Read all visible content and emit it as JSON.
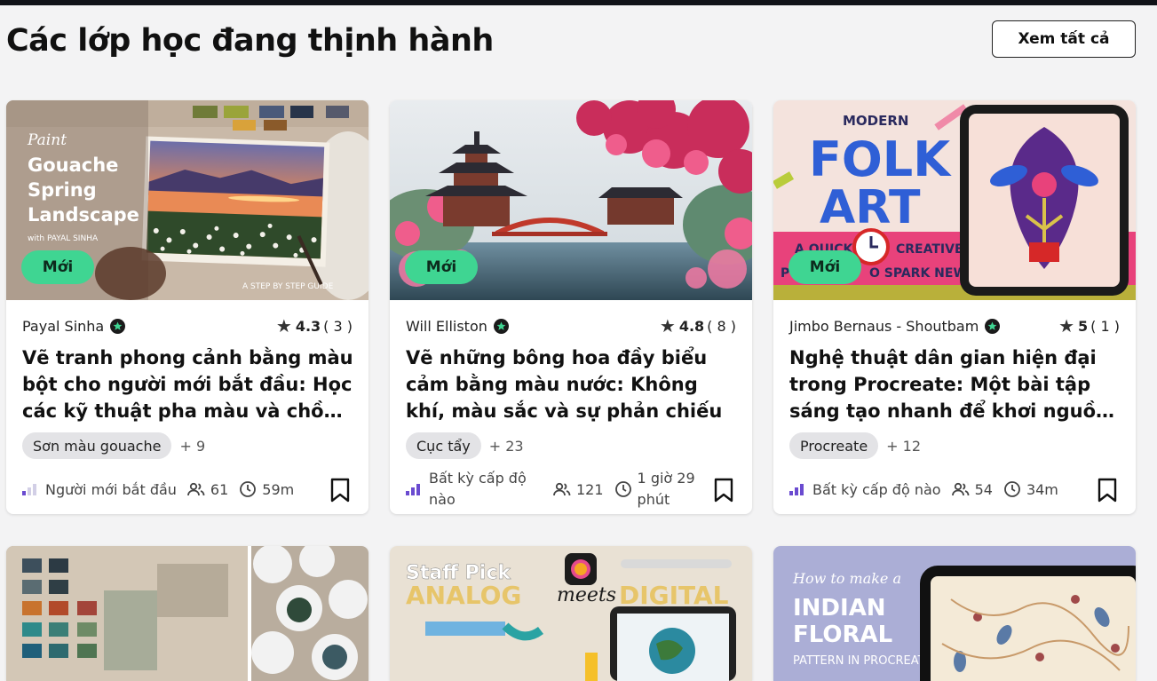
{
  "section": {
    "title": "Các lớp học đang thịnh hành",
    "see_all": "Xem tất cả"
  },
  "cards": [
    {
      "badge": "Mới",
      "thumb_text": [
        "Paint",
        "Gouache",
        "Spring",
        "Landscape",
        "with PAYAL SINHA",
        "A STEP BY STEP GUIDE"
      ],
      "author": "Payal Sinha",
      "rating": "4.3",
      "rating_count": "( 3 )",
      "title": "Vẽ tranh phong cảnh bằng màu bột cho người mới bắt đầu: Học các kỹ thuật pha màu và chồng lớp",
      "tag": "Sơn màu gouache",
      "tag_more": "+ 9",
      "level": "Người mới bắt đầu",
      "students": "61",
      "duration": "59m"
    },
    {
      "badge": "Mới",
      "author": "Will Elliston",
      "rating": "4.8",
      "rating_count": "( 8 )",
      "title": "Vẽ những bông hoa đầy biểu cảm bằng màu nước: Không khí, màu sắc và sự phản chiếu",
      "tag": "Cục tẩy",
      "tag_more": "+ 23",
      "level": "Bất kỳ cấp độ nào",
      "students": "121",
      "duration": "1 giờ 29 phút"
    },
    {
      "badge": "Mới",
      "thumb_text": [
        "MODERN",
        "FOLK",
        "ART",
        "A QUICK",
        "CREATIVE",
        "P",
        "O SPARK NEW IDEAS"
      ],
      "author": "Jimbo Bernaus - Shoutbam",
      "rating": "5",
      "rating_count": "( 1 )",
      "title": "Nghệ thuật dân gian hiện đại trong Procreate: Một bài tập sáng tạo nhanh để khơi nguồn ý tưởng mới",
      "tag": "Procreate",
      "tag_more": "+ 12",
      "level": "Bất kỳ cấp độ nào",
      "students": "54",
      "duration": "34m"
    }
  ],
  "row2": [
    {
      "thumb_text": []
    },
    {
      "thumb_text": [
        "Staff Pick",
        "ANALOG",
        "meets",
        "DIGITAL"
      ]
    },
    {
      "thumb_text": [
        "How to make a",
        "INDIAN",
        "FLORAL",
        "PATTERN IN PROCREATE"
      ]
    }
  ],
  "colors": {
    "badge": "#3fd592",
    "level_bar": "#6a4bd0",
    "level_bar_off": "#d2cfe6",
    "tag_bg": "#e3e3e6"
  },
  "icons": [
    "star-icon",
    "verified-icon",
    "students-icon",
    "clock-icon",
    "bookmark-icon",
    "level-bars-icon"
  ]
}
